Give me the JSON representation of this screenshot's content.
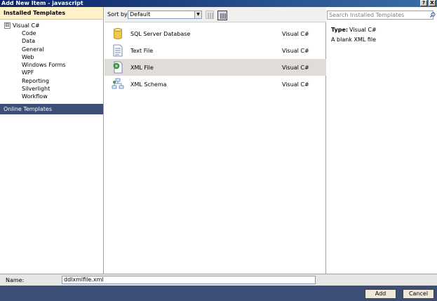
{
  "window": {
    "title": "Add New Item - javascript",
    "help_glyph": "?",
    "close_glyph": "X"
  },
  "left_panel": {
    "installed_header": "Installed Templates",
    "tree_root": {
      "expander": "⊟",
      "label": "Visual C#"
    },
    "tree_children": [
      "Code",
      "Data",
      "General",
      "Web",
      "Windows Forms",
      "WPF",
      "Reporting",
      "Silverlight",
      "Workflow"
    ],
    "online_templates": "Online Templates"
  },
  "toolbar": {
    "sort_label": "Sort by:",
    "sort_value": "Default",
    "sort_arrow": "▼"
  },
  "items": [
    {
      "name": "SQL Server Database",
      "lang": "Visual C#",
      "icon": "database-icon"
    },
    {
      "name": "Text File",
      "lang": "Visual C#",
      "icon": "text-file-icon"
    },
    {
      "name": "XML File",
      "lang": "Visual C#",
      "icon": "xml-file-icon",
      "selected": true
    },
    {
      "name": "XML Schema",
      "lang": "Visual C#",
      "icon": "xml-schema-icon"
    }
  ],
  "details": {
    "search_placeholder": "Search Installed Templates",
    "type_label": "Type:",
    "type_value": "Visual C#",
    "description": "A blank XML file"
  },
  "footer": {
    "name_label": "Name:",
    "name_value": "ddlxmlfile.xml",
    "add_label": "Add",
    "cancel_label": "Cancel"
  },
  "colors": {
    "title_bar": "#0a246a",
    "installed_header_bg": "#fff2c8",
    "online_templates_bg": "#3d4f77",
    "selected_row_bg": "#e0dcd8",
    "button_bar_bg": "#3d4f77"
  }
}
